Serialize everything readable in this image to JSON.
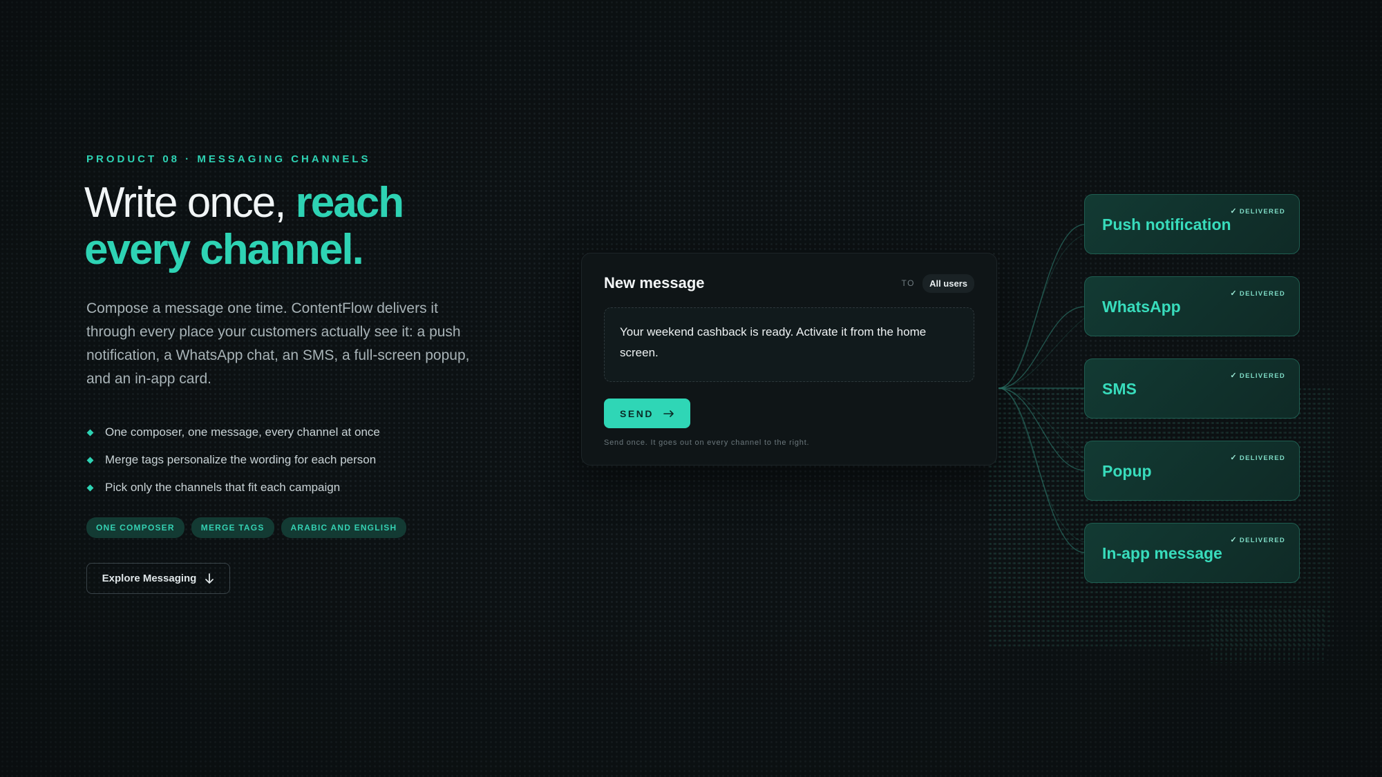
{
  "hero": {
    "eyebrow": "PRODUCT 08 · MESSAGING CHANNELS",
    "headline_plain": "Write once, ",
    "headline_accent_1": "reach",
    "headline_accent_2": "every channel.",
    "lede": "Compose a message one time. ContentFlow delivers it through every place your customers actually see it: a push notification, a WhatsApp chat, an SMS, a full-screen popup, and an in-app card.",
    "bullets": [
      "One composer, one message, every channel at once",
      "Merge tags personalize the wording for each person",
      "Pick only the channels that fit each campaign"
    ],
    "tags": [
      "ONE COMPOSER",
      "MERGE TAGS",
      "ARABIC AND ENGLISH"
    ],
    "cta_label": "Explore Messaging",
    "cta_icon": "arrow-down-icon"
  },
  "composer": {
    "title": "New message",
    "to_label": "TO",
    "audience": "All users",
    "message": "Your weekend cashback is ready. Activate it from the home screen.",
    "send_label": "SEND",
    "send_icon": "arrow-right-icon",
    "hint": "Send once. It goes out on every channel to the right."
  },
  "channels": [
    {
      "name": "Push notification",
      "status": "DELIVERED"
    },
    {
      "name": "WhatsApp",
      "status": "DELIVERED"
    },
    {
      "name": "SMS",
      "status": "DELIVERED"
    },
    {
      "name": "Popup",
      "status": "DELIVERED"
    },
    {
      "name": "In-app message",
      "status": "DELIVERED"
    }
  ],
  "colors": {
    "background": "#0c1113",
    "accent": "#2ed3b4",
    "card": "#0f1517",
    "channel_card": "#123a33"
  }
}
